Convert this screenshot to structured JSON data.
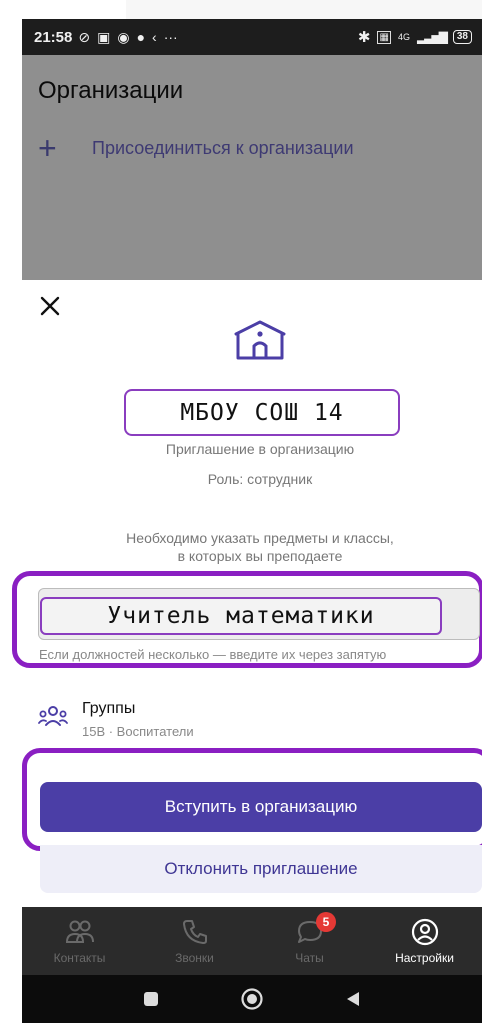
{
  "status_bar": {
    "time": "21:58",
    "left_icons": [
      "silent-icon",
      "sim-icon",
      "app-icon",
      "chat-icon",
      "signal-tool-icon"
    ],
    "more": "···",
    "network": "4G",
    "battery": "38"
  },
  "background_screen": {
    "title": "Организации",
    "join_plus": "+",
    "join_label": "Присоединиться к организации"
  },
  "sheet": {
    "org_name": "МБОУ СОШ 14",
    "invite_text": "Приглашение в организацию",
    "role_text": "Роль: сотрудник",
    "hint_line1": "Необходимо указать предметы и классы,",
    "hint_line2": "в которых вы преподаете",
    "position_value": "Учитель математики",
    "position_help": "Если должностей несколько — введите их через запятую",
    "groups_title": "Группы",
    "groups_sub": "15В · Воспитатели",
    "join_button": "Вступить в организацию",
    "decline_button": "Отклонить приглашение"
  },
  "bottom_nav": {
    "items": [
      {
        "label": "Контакты",
        "icon": "contacts-icon"
      },
      {
        "label": "Звонки",
        "icon": "phone-icon"
      },
      {
        "label": "Чаты",
        "icon": "chat-icon",
        "badge": "5"
      },
      {
        "label": "Настройки",
        "icon": "profile-icon",
        "active": true
      }
    ]
  },
  "colors": {
    "accent": "#4b3ea6",
    "highlight": "#8a1fc2",
    "badge": "#e53935"
  }
}
